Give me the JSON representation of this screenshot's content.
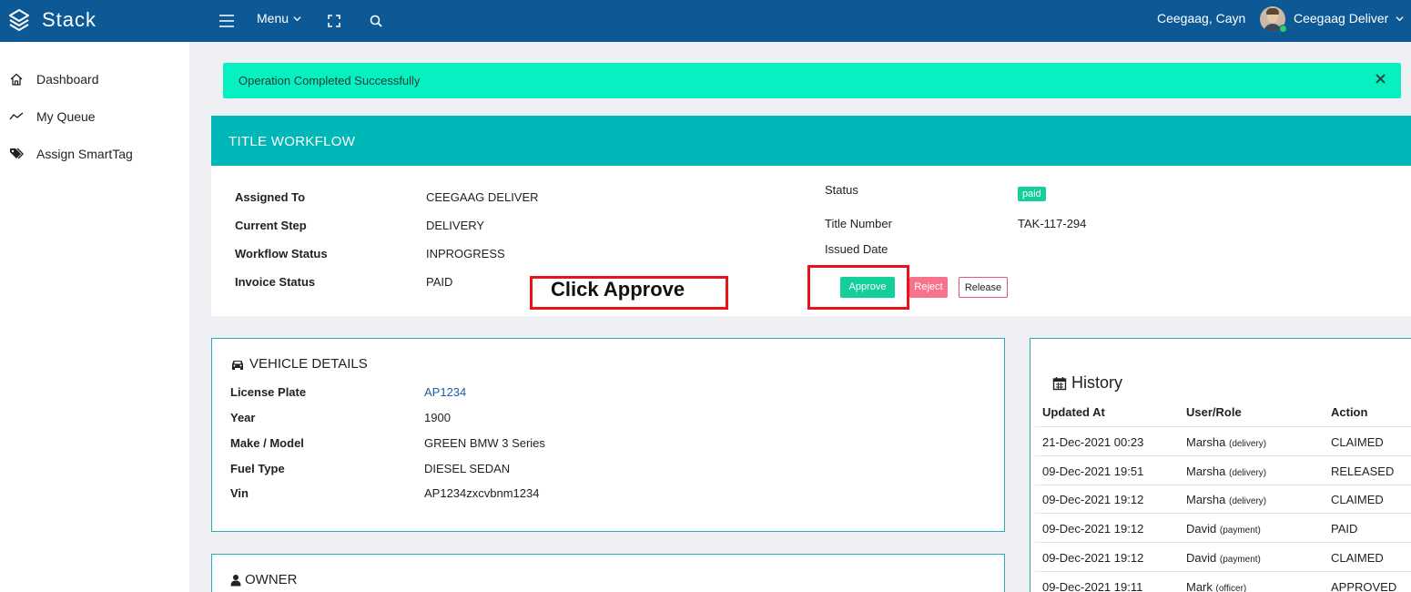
{
  "topbar": {
    "brand": "Stack",
    "menu_label": "Menu",
    "user_name": "Ceegaag, Cayn",
    "role_label": "Ceegaag Deliver"
  },
  "sidebar": {
    "items": [
      {
        "label": "Dashboard",
        "icon": "home-icon"
      },
      {
        "label": "My Queue",
        "icon": "trend-icon"
      },
      {
        "label": "Assign SmartTag",
        "icon": "tags-icon"
      }
    ]
  },
  "alert": {
    "text": "Operation Completed Successfully"
  },
  "workflow": {
    "title": "TITLE WORKFLOW",
    "fields": [
      {
        "label": "Assigned To",
        "value": "CEEGAAG DELIVER"
      },
      {
        "label": "Current Step",
        "value": "DELIVERY"
      },
      {
        "label": "Workflow Status",
        "value": "INPROGRESS"
      },
      {
        "label": "Invoice Status",
        "value": "PAID"
      }
    ],
    "status_label": "Status",
    "status_badge": "paid",
    "title_number_label": "Title Number",
    "title_number": "TAK-117-294",
    "issued_date_label": "Issued Date",
    "buttons": {
      "approve": "Approve",
      "reject": "Reject",
      "release": "Release"
    }
  },
  "annotation": {
    "text": "Click Approve",
    "color": "#e8131b"
  },
  "vehicle": {
    "title": "VEHICLE DETAILS",
    "fields": [
      {
        "label": "License Plate",
        "value": "AP1234"
      },
      {
        "label": "Year",
        "value": "1900"
      },
      {
        "label": "Make / Model",
        "value": "GREEN BMW 3 Series"
      },
      {
        "label": "Fuel Type",
        "value": "DIESEL SEDAN"
      },
      {
        "label": "Vin",
        "value": "AP1234zxcvbnm1234"
      }
    ]
  },
  "owner": {
    "title": "OWNER"
  },
  "history": {
    "title": "History",
    "columns": [
      "Updated At",
      "User/Role",
      "Action"
    ],
    "rows": [
      {
        "updated": "21-Dec-2021 00:23",
        "user": "Marsha",
        "role": "(delivery)",
        "action": "CLAIMED"
      },
      {
        "updated": "09-Dec-2021 19:51",
        "user": "Marsha",
        "role": "(delivery)",
        "action": "RELEASED"
      },
      {
        "updated": "09-Dec-2021 19:12",
        "user": "Marsha",
        "role": "(delivery)",
        "action": "CLAIMED"
      },
      {
        "updated": "09-Dec-2021 19:12",
        "user": "David",
        "role": "(payment)",
        "action": "PAID"
      },
      {
        "updated": "09-Dec-2021 19:12",
        "user": "David",
        "role": "(payment)",
        "action": "CLAIMED"
      },
      {
        "updated": "09-Dec-2021 19:11",
        "user": "Mark",
        "role": "(officer)",
        "action": "APPROVED"
      }
    ]
  },
  "colors": {
    "topbar": "#0d5996",
    "alert": "#06f0c2",
    "workflow_header": "#00b7b8",
    "approve": "#13cf9b",
    "reject": "#f7738c"
  }
}
